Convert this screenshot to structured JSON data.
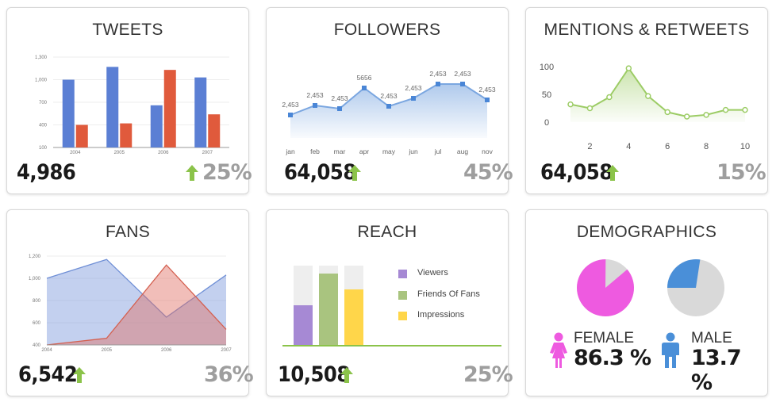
{
  "colors": {
    "blue": "#5b7fd4",
    "red": "#e05a3c",
    "green": "#8bc34a",
    "grey": "#9e9e9e",
    "lightblue": "#7aa6e0",
    "purple": "#a689d4",
    "sage": "#a9c47f",
    "yellow": "#ffd64a",
    "pink": "#ee5ae0",
    "maleblue": "#4a8fd8"
  },
  "tweets": {
    "title": "TWEETS",
    "value": "4,986",
    "percent": "25%",
    "chart_data": {
      "type": "bar",
      "categories": [
        "2004",
        "2005",
        "2006",
        "2007"
      ],
      "series": [
        {
          "values": [
            1000,
            1170,
            660,
            1030
          ]
        },
        {
          "values": [
            400,
            420,
            1130,
            540
          ]
        }
      ],
      "yticks": [
        "1,300",
        "1,000",
        "700",
        "400",
        "100"
      ],
      "ylim": [
        100,
        1300
      ]
    }
  },
  "followers": {
    "title": "FOLLOWERS",
    "value": "64,058",
    "percent": "45%",
    "chart_data": {
      "type": "area",
      "categories": [
        "jan",
        "feb",
        "mar",
        "apr",
        "may",
        "jun",
        "jul",
        "aug",
        "nov"
      ],
      "values": [
        2453,
        2453,
        2453,
        5656,
        2453,
        2453,
        2453,
        2453,
        2453
      ],
      "labels": [
        "2,453",
        "2,453",
        "2,453",
        "5656",
        "2,453",
        "2,453",
        "2,453",
        "2,453",
        "2,453"
      ]
    }
  },
  "mentions": {
    "title": "MENTIONS & RETWEETS",
    "value": "64,058",
    "percent": "15%",
    "chart_data": {
      "type": "area",
      "x": [
        1,
        2,
        3,
        4,
        5,
        6,
        7,
        8,
        9,
        10
      ],
      "y": [
        32,
        25,
        45,
        97,
        47,
        18,
        10,
        13,
        22,
        22
      ],
      "xticks": [
        "2",
        "4",
        "6",
        "8",
        "10"
      ],
      "yticks": [
        "100",
        "50",
        "0"
      ],
      "ylim": [
        0,
        100
      ]
    }
  },
  "fans": {
    "title": "FANS",
    "value": "6,542",
    "percent": "36%",
    "chart_data": {
      "type": "area",
      "categories": [
        "2004",
        "2005",
        "2006",
        "2007"
      ],
      "series": [
        {
          "values": [
            1000,
            1170,
            650,
            1030
          ]
        },
        {
          "values": [
            400,
            460,
            1120,
            540
          ]
        }
      ],
      "yticks": [
        "1,200",
        "1,000",
        "800",
        "600",
        "400"
      ],
      "ylim": [
        400,
        1200
      ]
    }
  },
  "reach": {
    "title": "REACH",
    "value": "10,508",
    "percent": "25%",
    "legend": [
      "Viewers",
      "Friends Of Fans",
      "Impressions"
    ],
    "chart_data": {
      "type": "bar",
      "series": [
        {
          "name": "Viewers",
          "value": 50
        },
        {
          "name": "Friends Of Fans",
          "value": 90
        },
        {
          "name": "Impressions",
          "value": 70
        }
      ],
      "max": 100
    }
  },
  "demographics": {
    "title": "DEMOGRAPHICS",
    "female_label": "FEMALE",
    "female_pct": "86.3 %",
    "male_label": "MALE",
    "male_pct": "13.7 %",
    "female_share": 0.863,
    "male_share": 0.274
  }
}
